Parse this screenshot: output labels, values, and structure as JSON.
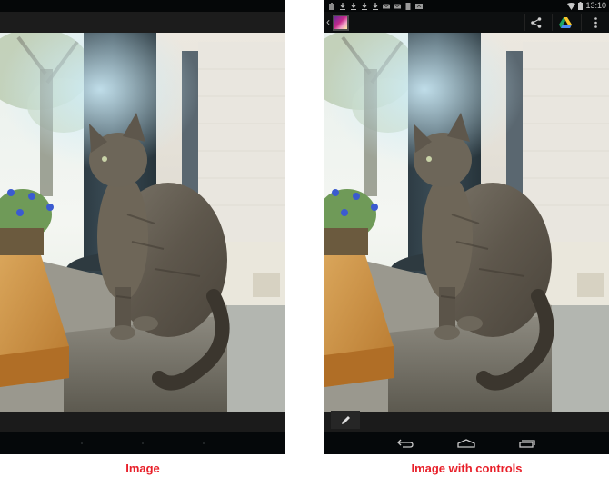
{
  "panels": [
    {
      "caption": "Image",
      "mode": "fullscreen"
    },
    {
      "caption": "Image with controls",
      "mode": "controls",
      "status_bar": {
        "notification_icons": [
          "screenshot-icon",
          "download-icon",
          "download-icon",
          "download-icon",
          "download-icon",
          "email-icon",
          "email-icon",
          "sd-card-icon",
          "photo-icon"
        ],
        "time": "13:10",
        "wifi": "wifi-icon",
        "battery": "battery-icon"
      },
      "action_bar": {
        "up_icon": "chevron-left-icon",
        "app_icon": "gallery-app-icon",
        "actions": [
          "share-icon",
          "google-drive-icon",
          "overflow-menu-icon"
        ]
      },
      "bottom_bar": {
        "edit_icon": "pencil-icon"
      },
      "nav_bar": {
        "buttons": [
          "back-icon",
          "home-icon",
          "recents-icon"
        ]
      }
    }
  ],
  "colors": {
    "caption": "#e8202a",
    "status_bar": "#050708",
    "action_bar": "#1c1c1c",
    "nav_bar": "#05080a"
  }
}
